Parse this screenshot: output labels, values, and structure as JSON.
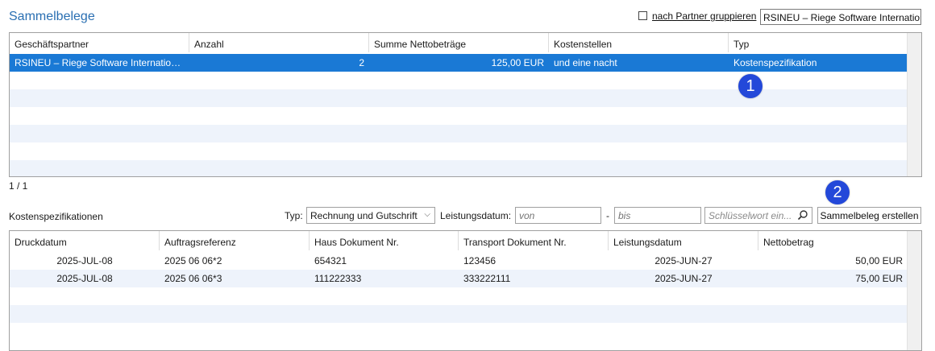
{
  "header": {
    "title": "Sammelbelege",
    "group_by_partner_label": "nach Partner gruppieren",
    "partner_filter_value": "RSINEU – Riege Software Internationa"
  },
  "sammelbelege_table": {
    "columns": [
      "Geschäftspartner",
      "Anzahl",
      "Summe Nettobeträge",
      "Kostenstellen",
      "Typ"
    ],
    "rows": [
      {
        "partner": "RSINEU – Riege Software International ...",
        "anzahl": "2",
        "summe": "125,00 EUR",
        "kostenstellen": "und eine nacht",
        "typ": "Kostenspezifikation",
        "selected": true
      }
    ],
    "pager": "1 / 1"
  },
  "badges": {
    "one": "1",
    "two": "2",
    "color": "#2348d9"
  },
  "kostenspezifikationen": {
    "title": "Kostenspezifikationen",
    "typ_label": "Typ:",
    "typ_value": "Rechnung und Gutschrift",
    "leistungsdatum_label": "Leistungsdatum:",
    "von_placeholder": "von",
    "dash": "-",
    "bis_placeholder": "bis",
    "search_placeholder": "Schlüsselwort ein...",
    "create_button": "Sammelbeleg erstellen",
    "columns": [
      "Druckdatum",
      "Auftragsreferenz",
      "Haus Dokument Nr.",
      "Transport Dokument Nr.",
      "Leistungsdatum",
      "Nettobetrag"
    ],
    "rows": [
      {
        "druckdatum": "2025-JUL-08",
        "auftragsreferenz": "2025 06 06*2",
        "haus": "654321",
        "transport": "123456",
        "leistungsdatum": "2025-JUN-27",
        "netto": "50,00 EUR"
      },
      {
        "druckdatum": "2025-JUL-08",
        "auftragsreferenz": "2025 06 06*3",
        "haus": "111222333",
        "transport": "333222111",
        "leistungsdatum": "2025-JUN-27",
        "netto": "75,00 EUR"
      }
    ]
  },
  "colors": {
    "title": "#2a6fb2",
    "selection": "#1a79d5",
    "alt_row": "#eef3fb"
  }
}
